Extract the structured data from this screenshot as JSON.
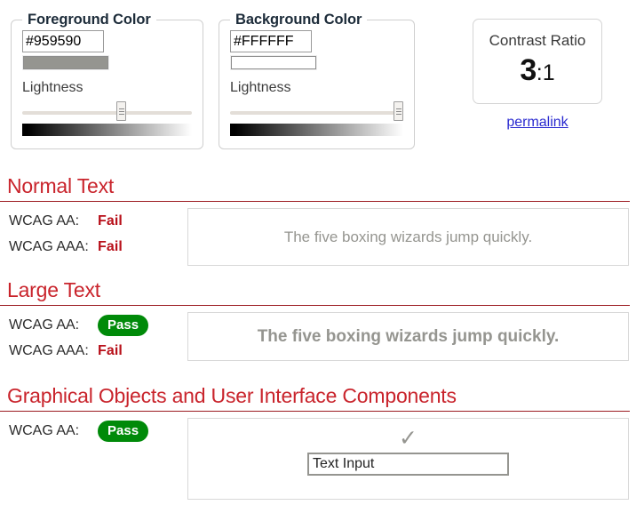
{
  "foreground": {
    "legend": "Foreground Color",
    "hex_value": "#959590",
    "hex_placeholder": "#000000",
    "swatch_color": "#959590",
    "lightness_label": "Lightness",
    "slider_percent": 59
  },
  "background": {
    "legend": "Background Color",
    "hex_value": "#FFFFFF",
    "hex_placeholder": "#FFFFFF",
    "swatch_color": "#FFFFFF",
    "lightness_label": "Lightness",
    "slider_percent": 100
  },
  "ratio_panel": {
    "title": "Contrast Ratio",
    "value_big": "3",
    "value_small": ":1",
    "permalink_label": "permalink"
  },
  "sections": [
    {
      "heading": "Normal Text",
      "criteria": [
        {
          "label": "WCAG AA:",
          "result": "Fail",
          "state": "fail"
        },
        {
          "label": "WCAG AAA:",
          "result": "Fail",
          "state": "fail"
        }
      ],
      "sample_text": "The five boxing wizards jump quickly."
    },
    {
      "heading": "Large Text",
      "criteria": [
        {
          "label": "WCAG AA:",
          "result": "Pass",
          "state": "pass"
        },
        {
          "label": "WCAG AAA:",
          "result": "Fail",
          "state": "fail"
        }
      ],
      "sample_text": "The five boxing wizards jump quickly."
    },
    {
      "heading": "Graphical Objects and User Interface Components",
      "criteria": [
        {
          "label": "WCAG AA:",
          "result": "Pass",
          "state": "pass"
        }
      ],
      "check_glyph": "✓",
      "input_value": "Text Input"
    }
  ],
  "colors": {
    "heading_red": "#c9242c",
    "fail_red": "#b8101a",
    "pass_green": "#008a09",
    "link_blue": "#2a2ad0",
    "sample_text_color": "#959590"
  }
}
